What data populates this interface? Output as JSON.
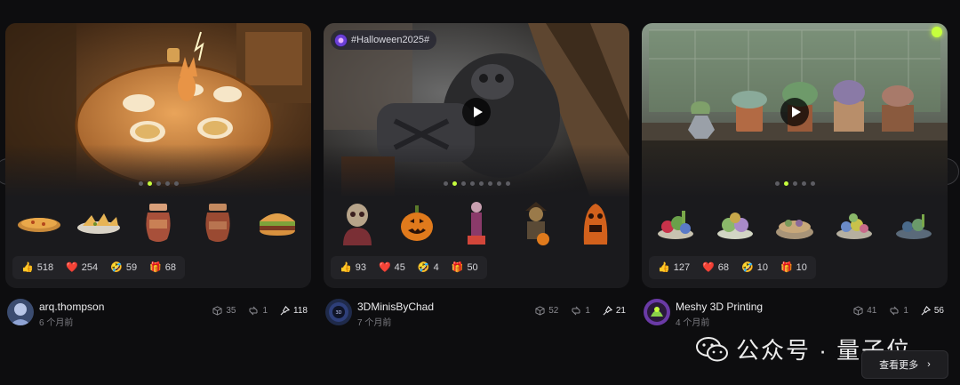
{
  "cards": [
    {
      "tag": null,
      "reactions": {
        "like": "518",
        "heart": "254",
        "laugh": "59",
        "gift": "68"
      },
      "user": {
        "name": "arq.thompson",
        "time": "6 个月前"
      },
      "stats": {
        "models": "35",
        "remixes": "1",
        "pins": "118"
      },
      "thumbs": [
        "pizza",
        "nachos",
        "jar",
        "jar",
        "burger"
      ]
    },
    {
      "tag": "#Halloween2025#",
      "reactions": {
        "like": "93",
        "heart": "45",
        "laugh": "4",
        "gift": "50"
      },
      "user": {
        "name": "3DMinisByChad",
        "time": "7 个月前"
      },
      "stats": {
        "models": "52",
        "remixes": "1",
        "pins": "21"
      },
      "thumbs": [
        "skull-bust",
        "pumpkin",
        "skeleton",
        "scarecrow",
        "ghoul"
      ]
    },
    {
      "tag": null,
      "reactions": {
        "like": "127",
        "heart": "68",
        "laugh": "10",
        "gift": "10"
      },
      "user": {
        "name": "Meshy 3D Printing",
        "time": "4 个月前"
      },
      "stats": {
        "models": "41",
        "remixes": "1",
        "pins": "56"
      },
      "thumbs": [
        "succulent",
        "succulent",
        "succulent",
        "succulent",
        "succulent"
      ]
    }
  ],
  "watermark": "公众号 · 量子位",
  "more_button": "查看更多",
  "colors": {
    "accent": "#c6ff3d",
    "card_bg": "#1a1a1d",
    "page_bg": "#0d0d0f"
  }
}
